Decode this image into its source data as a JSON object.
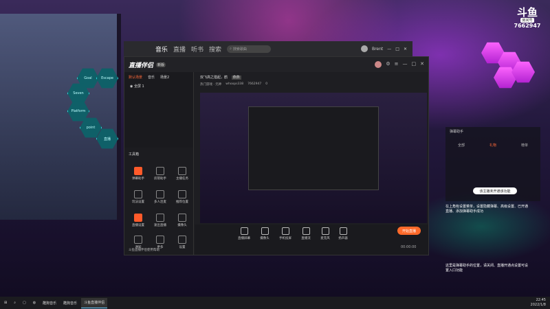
{
  "douyu": {
    "logo": "斗鱼",
    "tag": "房间号",
    "room": "7662947"
  },
  "hexes": [
    "Goal",
    "Escape",
    "Seven",
    "Platform",
    "point",
    "直播"
  ],
  "music": {
    "tabs": [
      "音乐",
      "直播",
      "听书",
      "搜索"
    ],
    "search_placeholder": "搜索歌曲",
    "user": "Brent"
  },
  "app": {
    "logo": "直播伴侣",
    "version": "新版",
    "scene_tabs": [
      "默认场景",
      "音乐",
      "场景2"
    ],
    "scene_item": "全屏 1",
    "tools_title": "工具箱",
    "tools": [
      "弹幕助手",
      "房管助手",
      "主播任务",
      "玩法设置",
      "多人连麦",
      "推荐位置",
      "直播设置",
      "速出直播",
      "摄像头",
      "通知",
      "更多",
      "设置"
    ],
    "stream_title": "双飞高之猎起，鹤",
    "stream_tag": "燕燕",
    "category": "热门游戏 · 元神",
    "uid": "whoops338",
    "room": "7662947",
    "fans": "0",
    "bottom": [
      "直播屏幕",
      "摄像头",
      "手机投屏",
      "直播流",
      "麦克风",
      "扬声器"
    ],
    "start_label": "开始直播",
    "time": "00:00:00",
    "footer": "斗鱼直播伴侣使用帮助"
  },
  "assist": {
    "title": "弹幕助手",
    "tabs": [
      "全部",
      "礼物",
      "榜单"
    ],
    "bubble": "该主播未开通该功能",
    "msg1": "在上角有设置菜单，设置隐藏弹幕、高级设置、已开通直播、添加弹幕助手成功",
    "msg2": "这里是弹幕助手的位置，请关闭、直播开通点设置可设置入口功能"
  },
  "taskbar": {
    "items": [
      "酷狗音乐",
      "酷狗音乐",
      "斗鱼直播伴侣"
    ],
    "time": "22:45",
    "date": "2022/1/8"
  }
}
